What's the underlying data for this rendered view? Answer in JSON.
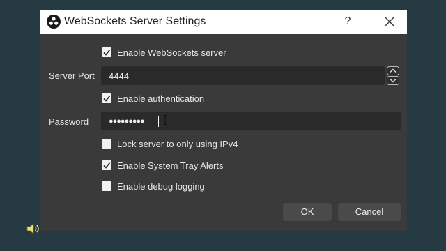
{
  "dialog": {
    "title": "WebSockets Server Settings",
    "help_glyph": "?",
    "close_icon": "close-icon",
    "app_icon": "obs-logo-icon"
  },
  "form": {
    "enable_server": {
      "label": "Enable WebSockets server",
      "checked": true
    },
    "server_port": {
      "label": "Server Port",
      "value": "4444"
    },
    "enable_auth": {
      "label": "Enable authentication",
      "checked": true
    },
    "password": {
      "label": "Password",
      "value": "●●●●●●●●●"
    },
    "lock_ipv4": {
      "label": "Lock server to only using IPv4",
      "checked": false
    },
    "tray_alerts": {
      "label": "Enable System Tray Alerts",
      "checked": true
    },
    "debug_logging": {
      "label": "Enable debug logging",
      "checked": false
    }
  },
  "buttons": {
    "ok": "OK",
    "cancel": "Cancel"
  },
  "colors": {
    "background": "#263a44",
    "dialog": "#3a3a3a",
    "field": "#2a2a2a",
    "button": "#4a4a4a"
  }
}
